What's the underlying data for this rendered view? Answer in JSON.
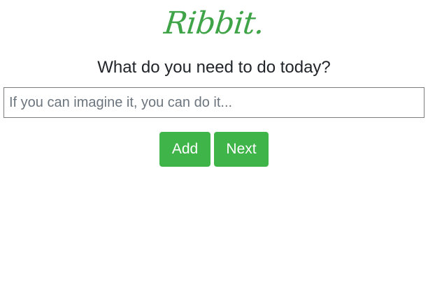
{
  "app": {
    "logo_text": "Ribbit."
  },
  "main": {
    "prompt": "What do you need to do today?",
    "task_input": {
      "value": "",
      "placeholder": "If you can imagine it, you can do it..."
    },
    "buttons": {
      "add_label": "Add",
      "next_label": "Next"
    }
  },
  "colors": {
    "brand_green": "#3fa447",
    "button_green": "#3fb449",
    "text_dark": "#212529",
    "placeholder_gray": "#6c757d"
  }
}
